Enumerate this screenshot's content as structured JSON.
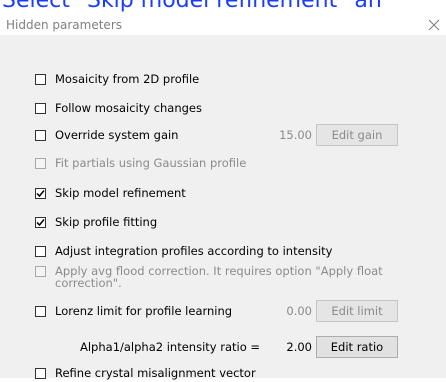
{
  "banner": {
    "text": "Select \"Skip model refinement\" an"
  },
  "window": {
    "title": "Hidden parameters",
    "close_glyph": "close-icon"
  },
  "options": {
    "mosaicity_2d": {
      "label": "Mosaicity from 2D profile",
      "checked": false,
      "enabled": true
    },
    "follow_mosaicity": {
      "label": "Follow mosaicity changes",
      "checked": false,
      "enabled": true
    },
    "override_gain": {
      "label": "Override system gain",
      "checked": false,
      "enabled": true
    },
    "fit_partials": {
      "label": "Fit partials using Gaussian profile",
      "checked": false,
      "enabled": false
    },
    "skip_model": {
      "label": "Skip model refinement",
      "checked": true,
      "enabled": true
    },
    "skip_profile": {
      "label": "Skip profile fitting",
      "checked": true,
      "enabled": true
    },
    "adjust_profiles": {
      "label": "Adjust integration profiles according to intensity",
      "checked": false,
      "enabled": true
    },
    "flood_correction": {
      "label": "Apply avg flood correction. It requires option \"Apply float correction\".",
      "checked": false,
      "enabled": false
    },
    "lorenz_limit": {
      "label": "Lorenz limit for profile learning",
      "checked": false,
      "enabled": true
    },
    "refine_crystal": {
      "label": "Refine crystal misalignment vector",
      "checked": false,
      "enabled": true
    }
  },
  "gain": {
    "value": "15.00",
    "button": "Edit gain"
  },
  "lorenz": {
    "value": "0.00",
    "button": "Edit limit"
  },
  "alpha": {
    "label": "Alpha1/alpha2 intensity ratio =",
    "value": "2.00",
    "button": "Edit ratio"
  }
}
